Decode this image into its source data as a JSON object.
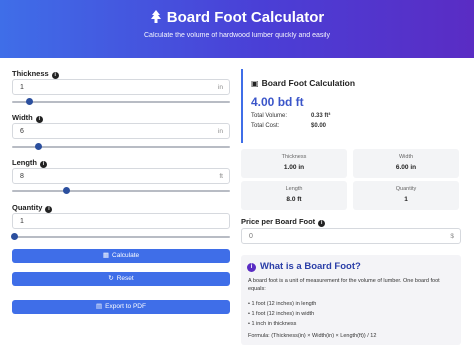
{
  "header": {
    "title": "Board Foot Calculator",
    "subtitle": "Calculate the volume of hardwood lumber quickly and easily",
    "logo_icon": "tree-icon"
  },
  "inputs": {
    "thickness": {
      "label": "Thickness",
      "value": "1",
      "unit": "in",
      "slider_fraction": 0.08
    },
    "width": {
      "label": "Width",
      "value": "6",
      "unit": "in",
      "slider_fraction": 0.12
    },
    "length": {
      "label": "Length",
      "value": "8",
      "unit": "ft",
      "slider_fraction": 0.25
    },
    "quantity": {
      "label": "Quantity",
      "value": "1",
      "unit": "",
      "slider_fraction": 0.01
    }
  },
  "buttons": {
    "calculate": "Calculate",
    "reset": "Reset",
    "export": "Export to PDF"
  },
  "result": {
    "title": "Board Foot Calculation",
    "value": "4.00 bd ft",
    "total_volume_label": "Total Volume:",
    "total_volume": "0.33 ft³",
    "total_cost_label": "Total Cost:",
    "total_cost": "$0.00"
  },
  "stats": [
    {
      "label": "Thickness",
      "value": "1.00 in"
    },
    {
      "label": "Width",
      "value": "6.00 in"
    },
    {
      "label": "Length",
      "value": "8.0 ft"
    },
    {
      "label": "Quantity",
      "value": "1"
    }
  ],
  "price": {
    "label": "Price per Board Foot",
    "value": "0",
    "unit": "$"
  },
  "info": {
    "title": "What is a Board Foot?",
    "description": "A board foot is a unit of measurement for the volume of lumber. One board foot equals:",
    "items": [
      "1 foot (12 inches) in length",
      "1 foot (12 inches) in width",
      "1 inch in thickness"
    ],
    "formula": "Formula: (Thickness(in) × Width(in) × Length(ft)) / 12"
  },
  "colors": {
    "accent": "#3f6ee8",
    "header_gradient_end": "#5a2cc4",
    "result_value": "#3a55c9"
  }
}
